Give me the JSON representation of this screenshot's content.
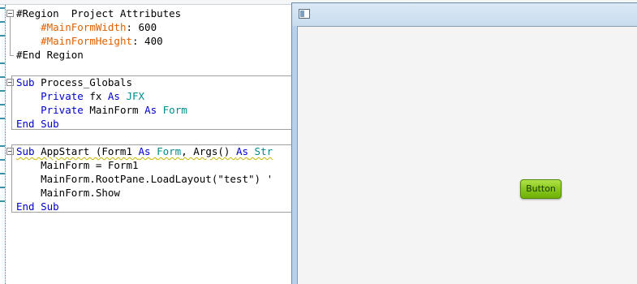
{
  "editor": {
    "lines": [
      {
        "tokens": [
          {
            "t": "#Region  Project Attributes",
            "c": "plain"
          }
        ]
      },
      {
        "tokens": [
          {
            "t": "    ",
            "c": "plain"
          },
          {
            "t": "#MainFormWidth",
            "c": "attr"
          },
          {
            "t": ": 600",
            "c": "plain"
          }
        ]
      },
      {
        "tokens": [
          {
            "t": "    ",
            "c": "plain"
          },
          {
            "t": "#MainFormHeight",
            "c": "attr"
          },
          {
            "t": ": 400",
            "c": "plain"
          }
        ]
      },
      {
        "tokens": [
          {
            "t": "#End Region",
            "c": "plain"
          }
        ]
      },
      {
        "tokens": []
      },
      {
        "tokens": [
          {
            "t": "Sub",
            "c": "kw"
          },
          {
            "t": " Process_Globals",
            "c": "plain"
          }
        ]
      },
      {
        "tokens": [
          {
            "t": "    ",
            "c": "plain"
          },
          {
            "t": "Private",
            "c": "kw"
          },
          {
            "t": " fx ",
            "c": "plain"
          },
          {
            "t": "As",
            "c": "kw"
          },
          {
            "t": " ",
            "c": "plain"
          },
          {
            "t": "JFX",
            "c": "ty"
          }
        ]
      },
      {
        "tokens": [
          {
            "t": "    ",
            "c": "plain"
          },
          {
            "t": "Private",
            "c": "kw"
          },
          {
            "t": " MainForm ",
            "c": "plain"
          },
          {
            "t": "As",
            "c": "kw"
          },
          {
            "t": " ",
            "c": "plain"
          },
          {
            "t": "Form",
            "c": "ty"
          }
        ]
      },
      {
        "tokens": [
          {
            "t": "End Sub",
            "c": "kw"
          }
        ]
      },
      {
        "tokens": []
      },
      {
        "tokens": [
          {
            "t": "Sub",
            "c": "kw",
            "sq": true
          },
          {
            "t": " AppStart (Form1 ",
            "c": "plain",
            "sq": true
          },
          {
            "t": "As",
            "c": "kw",
            "sq": true
          },
          {
            "t": " ",
            "c": "plain",
            "sq": true
          },
          {
            "t": "Form",
            "c": "ty",
            "sq": true
          },
          {
            "t": ", Args() ",
            "c": "plain",
            "sq": true
          },
          {
            "t": "As",
            "c": "kw",
            "sq": true
          },
          {
            "t": " ",
            "c": "plain",
            "sq": true
          },
          {
            "t": "Str",
            "c": "ty",
            "sq": true
          }
        ]
      },
      {
        "tokens": [
          {
            "t": "    MainForm = Form1",
            "c": "plain"
          }
        ]
      },
      {
        "tokens": [
          {
            "t": "    MainForm.RootPane.LoadLayout(",
            "c": "plain"
          },
          {
            "t": "\"test\"",
            "c": "plain"
          },
          {
            "t": ") '",
            "c": "plain"
          }
        ]
      },
      {
        "tokens": [
          {
            "t": "    MainForm.Show",
            "c": "plain"
          }
        ]
      },
      {
        "tokens": [
          {
            "t": "End Sub",
            "c": "kw"
          }
        ]
      }
    ]
  },
  "form_window": {
    "icon": "window-icon",
    "button_label": "Button"
  },
  "colors": {
    "keyword": "#0000cc",
    "type": "#008b8b",
    "attribute": "#e06000",
    "button_green": "#86c81a"
  }
}
